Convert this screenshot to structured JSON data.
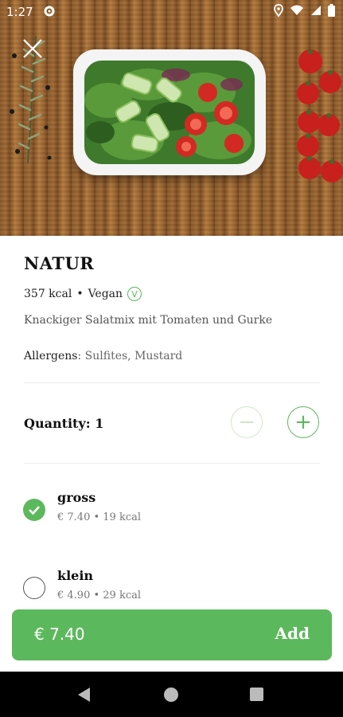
{
  "status_bar": {
    "time": "1:27",
    "icons": [
      "gear-icon",
      "location-icon",
      "wifi-icon",
      "signal-icon",
      "battery-icon"
    ]
  },
  "hero": {
    "image": "salad-bowl-photo",
    "close_icon": "close-icon"
  },
  "product": {
    "title": "NATUR",
    "kcal": "357 kcal",
    "separator": "•",
    "diet": "Vegan",
    "diet_badge": "V",
    "description": "Knackiger Salatmix mit Tomaten und Gurke",
    "allergens_label": "Allergens",
    "allergens_value": ": Sulfites, Mustard"
  },
  "quantity": {
    "label": "Quantity: 1",
    "minus": "−",
    "plus": "+"
  },
  "options": [
    {
      "name": "gross",
      "details": "€ 7.40 • 19 kcal",
      "selected": true
    },
    {
      "name": "klein",
      "details": "€ 4.90 • 29 kcal",
      "selected": false
    }
  ],
  "cta": {
    "price": "€ 7.40",
    "label": "Add"
  },
  "colors": {
    "accent": "#5cb85c",
    "accent_disabled": "#cfe8c8",
    "text": "#111111",
    "muted": "#777777",
    "nav_bg": "#000000"
  },
  "nav": {
    "icons": [
      "back-icon",
      "home-icon",
      "recents-icon"
    ]
  }
}
